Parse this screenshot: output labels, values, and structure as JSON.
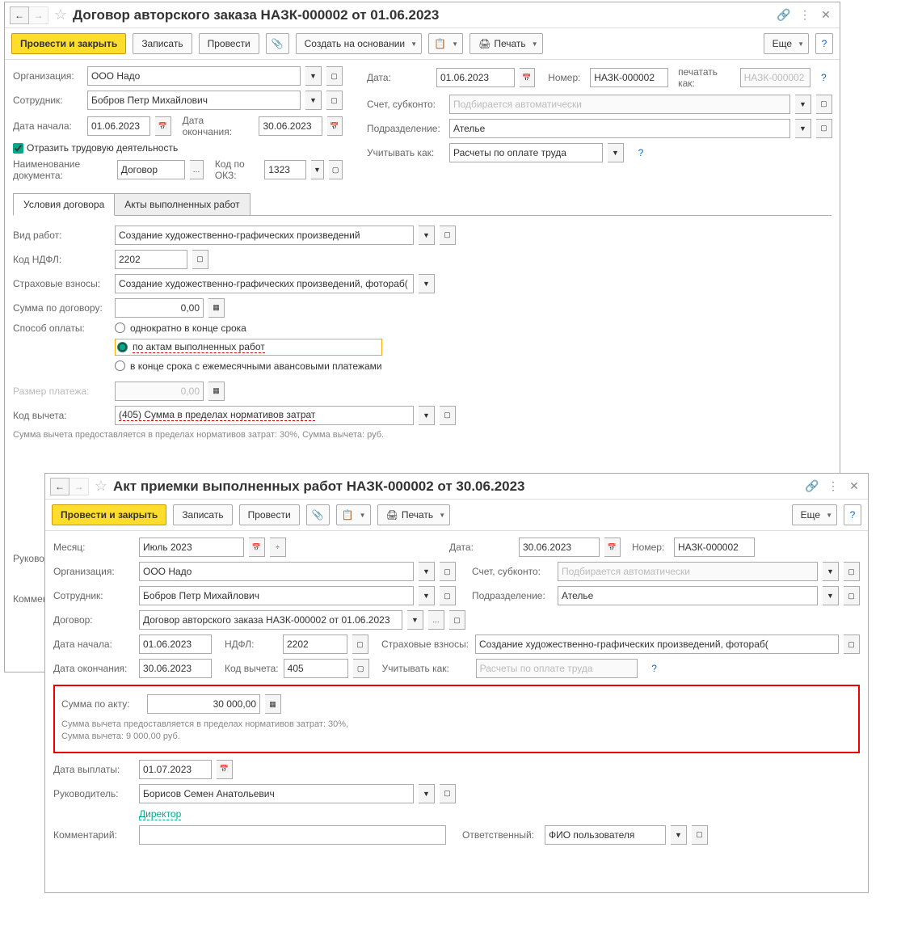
{
  "w1": {
    "title": "Договор авторского заказа НАЗК-000002 от 01.06.2023",
    "tb": {
      "post_close": "Провести и закрыть",
      "write": "Записать",
      "post": "Провести",
      "create_based": "Создать на основании",
      "print": "Печать",
      "more": "Еще"
    },
    "org_l": "Организация:",
    "org": "ООО Надо",
    "date_l": "Дата:",
    "date": "01.06.2023",
    "num_l": "Номер:",
    "num": "НАЗК-000002",
    "print_as_l": "печатать как:",
    "print_as_ph": "НАЗК-000002",
    "emp_l": "Сотрудник:",
    "emp": "Бобров Петр Михайлович",
    "acc_l": "Счет, субконто:",
    "acc_ph": "Подбирается автоматически",
    "dstart_l": "Дата начала:",
    "dstart": "01.06.2023",
    "dend_l": "Дата окончания:",
    "dend": "30.06.2023",
    "dept_l": "Подразделение:",
    "dept": "Ателье",
    "reflect": "Отразить трудовую деятельность",
    "consider_l": "Учитывать как:",
    "consider": "Расчеты по оплате труда",
    "docname_l": "Наименование документа:",
    "docname": "Договор",
    "okz_l": "Код по ОКЗ:",
    "okz": "1323",
    "tab1": "Условия договора",
    "tab2": "Акты выполненных работ",
    "worktype_l": "Вид работ:",
    "worktype": "Создание художественно-графических произведений",
    "ndfl_l": "Код НДФЛ:",
    "ndfl": "2202",
    "ins_l": "Страховые взносы:",
    "ins": "Создание художественно-графических произведений, фотораб(",
    "sum_l": "Сумма по договору:",
    "sum": "0,00",
    "pay_l": "Способ оплаты:",
    "pay1": "однократно в конце срока",
    "pay2": "по актам выполненных работ",
    "pay3": "в конце срока с ежемесячными авансовыми платежами",
    "paysize_l": "Размер платежа:",
    "paysize": "0,00",
    "deduct_l": "Код вычета:",
    "deduct": "(405) Сумма в пределах нормативов затрат",
    "deduct_info": "Сумма вычета предоставляется в пределах нормативов затрат: 30%,  Сумма вычета:  руб.",
    "mgr_l": "Руководи",
    "comm_l": "Коммент"
  },
  "w2": {
    "title": "Акт приемки выполненных работ НАЗК-000002 от 30.06.2023",
    "tb": {
      "post_close": "Провести и закрыть",
      "write": "Записать",
      "post": "Провести",
      "print": "Печать",
      "more": "Еще"
    },
    "month_l": "Месяц:",
    "month": "Июль 2023",
    "date_l": "Дата:",
    "date": "30.06.2023",
    "num_l": "Номер:",
    "num": "НАЗК-000002",
    "org_l": "Организация:",
    "org": "ООО Надо",
    "acc_l": "Счет, субконто:",
    "acc_ph": "Подбирается автоматически",
    "emp_l": "Сотрудник:",
    "emp": "Бобров Петр Михайлович",
    "dept_l": "Подразделение:",
    "dept": "Ателье",
    "contract_l": "Договор:",
    "contract": "Договор авторского заказа НАЗК-000002 от 01.06.2023",
    "dstart_l": "Дата начала:",
    "dstart": "01.06.2023",
    "ndfl_l": "НДФЛ:",
    "ndfl": "2202",
    "ins_l": "Страховые взносы:",
    "ins": "Создание художественно-графических произведений, фотораб(",
    "dend_l": "Дата окончания:",
    "dend": "30.06.2023",
    "deduct_l": "Код вычета:",
    "deduct": "405",
    "consider_l": "Учитывать как:",
    "consider_ph": "Расчеты по оплате труда",
    "actsum_l": "Сумма по акту:",
    "actsum": "30 000,00",
    "deduct_info": "Сумма вычета предоставляется в пределах нормативов затрат: 30%,  Сумма вычета: 9 000,00 руб.",
    "paydate_l": "Дата выплаты:",
    "paydate": "01.07.2023",
    "mgr_l": "Руководитель:",
    "mgr": "Борисов Семен Анатольевич",
    "mgr_pos": "Директор",
    "comm_l": "Комментарий:",
    "resp_l": "Ответственный:",
    "resp": "ФИО пользователя"
  }
}
